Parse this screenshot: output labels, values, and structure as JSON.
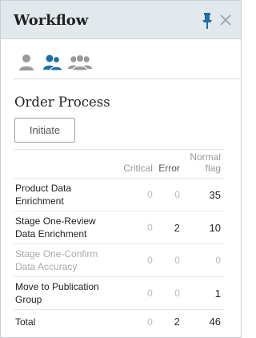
{
  "header": {
    "title": "Workflow"
  },
  "icons": {
    "pin": "pin-icon",
    "close": "close-icon",
    "users": [
      "single-user-icon",
      "two-users-icon",
      "three-users-icon"
    ]
  },
  "colors": {
    "header_bg": "#e3e8ec",
    "accent_blue": "#1d6fa5",
    "muted_gray": "#999999"
  },
  "section": {
    "title": "Order Process",
    "initiate_label": "Initiate"
  },
  "table": {
    "headers": {
      "critical": "Critical",
      "error": "Error",
      "normal_flag_line1": "Normal",
      "normal_flag_line2": "flag"
    },
    "rows": [
      {
        "name": "Product Data Enrichment",
        "critical": "0",
        "error": "0",
        "normal_flag": "35"
      },
      {
        "name": "Stage One-Review Data Enrichment",
        "critical": "0",
        "error": "2",
        "normal_flag": "10"
      },
      {
        "name": "Stage One-Confirm Data Accuracy",
        "critical": "0",
        "error": "0",
        "normal_flag": "0"
      },
      {
        "name": "Move to Publication Group",
        "critical": "0",
        "error": "0",
        "normal_flag": "1"
      }
    ],
    "total": {
      "name": "Total",
      "critical": "0",
      "error": "2",
      "normal_flag": "46"
    }
  }
}
